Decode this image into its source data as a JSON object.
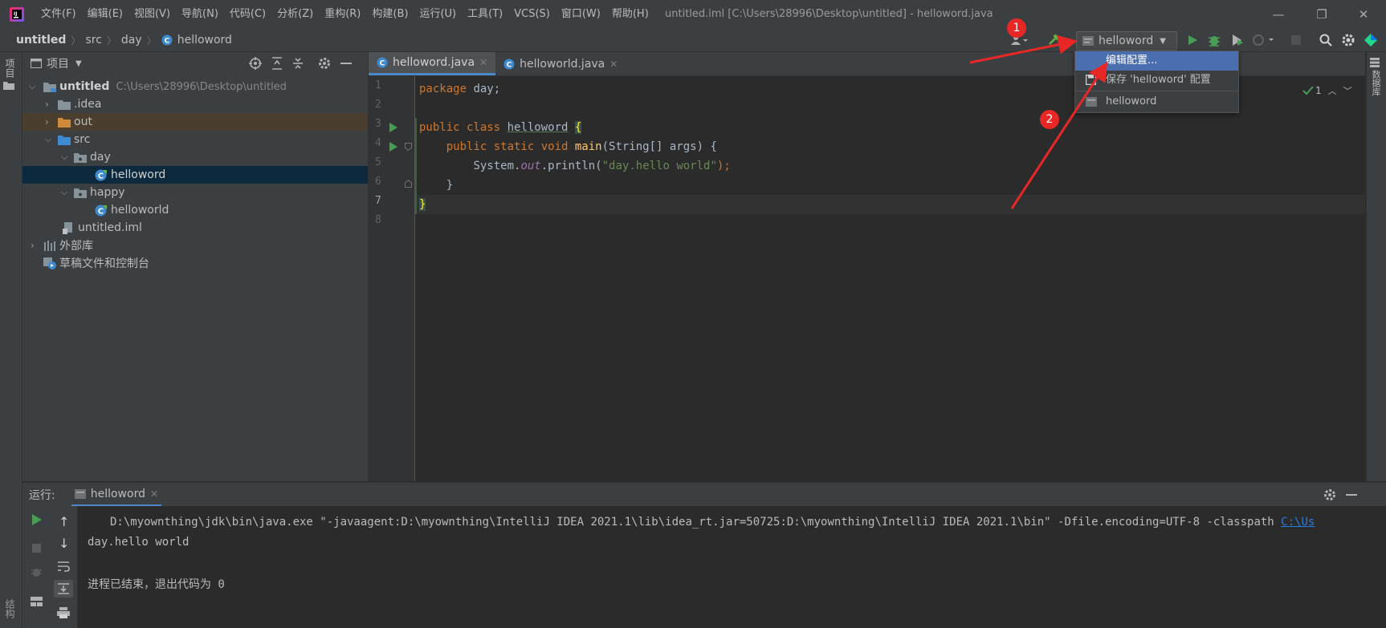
{
  "menu": [
    "文件(F)",
    "编辑(E)",
    "视图(V)",
    "导航(N)",
    "代码(C)",
    "分析(Z)",
    "重构(R)",
    "构建(B)",
    "运行(U)",
    "工具(T)",
    "VCS(S)",
    "窗口(W)",
    "帮助(H)"
  ],
  "window_title": "untitled.iml [C:\\Users\\28996\\Desktop\\untitled] - helloword.java",
  "breadcrumb": [
    "untitled",
    "src",
    "day",
    "helloword"
  ],
  "run_config": "helloword",
  "popup": {
    "items": [
      "编辑配置...",
      "保存 'helloword' 配置",
      "helloword"
    ]
  },
  "project_panel": {
    "title": "项目",
    "tree": [
      {
        "label": "untitled",
        "path": "C:\\Users\\28996\\Desktop\\untitled"
      },
      {
        "label": ".idea"
      },
      {
        "label": "out"
      },
      {
        "label": "src"
      },
      {
        "label": "day"
      },
      {
        "label": "helloword"
      },
      {
        "label": "happy"
      },
      {
        "label": "helloworld"
      },
      {
        "label": "untitled.iml"
      },
      {
        "label": "外部库"
      },
      {
        "label": "草稿文件和控制台"
      }
    ]
  },
  "left_strip": {
    "project": "项目",
    "structure": "结构"
  },
  "right_strip": {
    "database": "数据库"
  },
  "editor": {
    "tabs": [
      "helloword.java",
      "helloworld.java"
    ],
    "line_numbers": [
      "1",
      "2",
      "3",
      "4",
      "5",
      "6",
      "7",
      "8"
    ],
    "code": {
      "l1_kw": "package",
      "l1_rest": " day;",
      "l3_kw": "public class",
      "l3_cls": "helloword",
      "l3_brace": "{",
      "l4_kw": "public static void",
      "l4_fn": "main",
      "l4_rest": "(String[] args) {",
      "l5_a": "System.",
      "l5_fld": "out",
      "l5_b": ".println(",
      "l5_str": "\"day.hello world\"",
      "l5_c": ");",
      "l6": "}",
      "l7": "}"
    },
    "inspection_count": "1"
  },
  "run_panel": {
    "label": "运行:",
    "tab": "helloword",
    "output": {
      "cmd": "D:\\myownthing\\jdk\\bin\\java.exe \"-javaagent:D:\\myownthing\\IntelliJ IDEA 2021.1\\lib\\idea_rt.jar=50725:D:\\myownthing\\IntelliJ IDEA 2021.1\\bin\" -Dfile.encoding=UTF-8 -classpath ",
      "cmd_link": "C:\\Us",
      "line2": "day.hello world",
      "line3": "进程已结束，退出代码为 0"
    }
  },
  "annotations": {
    "badge1": "1",
    "badge2": "2"
  },
  "colors": {
    "accent": "#4b6eaf",
    "arrow": "#e82727",
    "run_green": "#499c54"
  }
}
